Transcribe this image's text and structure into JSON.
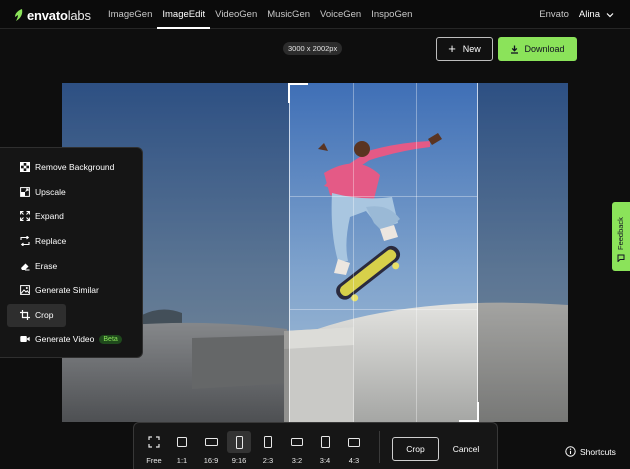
{
  "header": {
    "logo_bold": "envato",
    "logo_thin": "labs",
    "nav": [
      {
        "label": "ImageGen"
      },
      {
        "label": "ImageEdit",
        "active": true
      },
      {
        "label": "VideoGen"
      },
      {
        "label": "MusicGen"
      },
      {
        "label": "VoiceGen"
      },
      {
        "label": "InspoGen"
      }
    ],
    "envato_link": "Envato",
    "user_name": "Alina"
  },
  "canvas": {
    "dimensions": "3000 x 2002px"
  },
  "actions": {
    "new_label": "New",
    "download_label": "Download"
  },
  "tools": [
    {
      "label": "Remove Background",
      "icon": "checker-icon"
    },
    {
      "label": "Upscale",
      "icon": "upscale-icon"
    },
    {
      "label": "Expand",
      "icon": "expand-icon"
    },
    {
      "label": "Replace",
      "icon": "replace-icon"
    },
    {
      "label": "Erase",
      "icon": "eraser-icon"
    },
    {
      "label": "Generate Similar",
      "icon": "image-stack-icon"
    },
    {
      "label": "Crop",
      "icon": "crop-icon",
      "active": true
    },
    {
      "label": "Generate Video",
      "icon": "video-icon",
      "badge": "Beta"
    }
  ],
  "feedback_label": "Feedback",
  "crop_bar": {
    "ratios": [
      {
        "label": "Free",
        "icon": "free-crop-icon"
      },
      {
        "label": "1:1"
      },
      {
        "label": "16:9"
      },
      {
        "label": "9:16",
        "active": true
      },
      {
        "label": "2:3"
      },
      {
        "label": "3:2"
      },
      {
        "label": "3:4"
      },
      {
        "label": "4:3"
      }
    ],
    "crop_label": "Crop",
    "cancel_label": "Cancel"
  },
  "shortcuts_label": "Shortcuts",
  "colors": {
    "accent": "#8be35a",
    "background": "#0e0e0e",
    "panel": "#151515"
  }
}
